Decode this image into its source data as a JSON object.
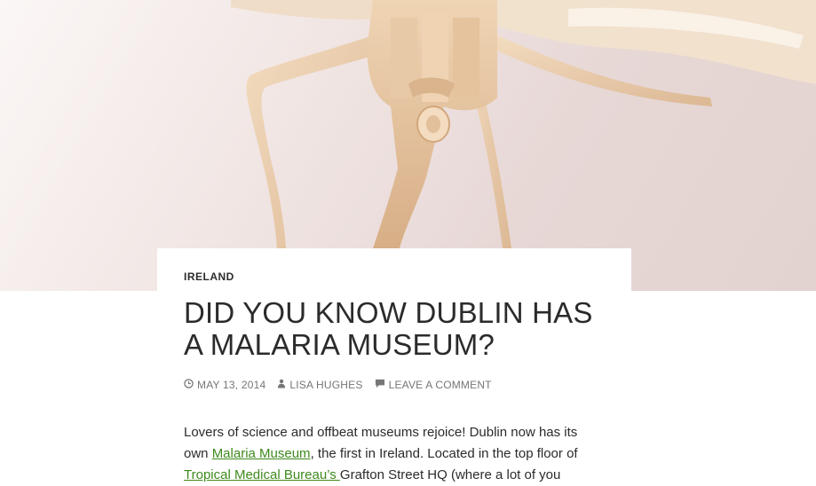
{
  "hero": {
    "image": "wooden-dragonfly-model-photo"
  },
  "post": {
    "category": "IRELAND",
    "title": "DID YOU KNOW DUBLIN HAS A MALARIA MUSEUM?",
    "meta": {
      "date": "MAY 13, 2014",
      "author": "LISA HUGHES",
      "comments": "LEAVE A COMMENT"
    },
    "body": {
      "p1_before": "Lovers of science and offbeat museums rejoice! Dublin now has its own ",
      "link1": "Malaria Museum",
      "p1_middle": ", the first in Ireland. Located in the top floor of ",
      "link2": "Tropical Medical Bureau’s ",
      "p1_after": "Grafton Street HQ (where a lot of you"
    }
  },
  "colors": {
    "link": "#3e8a1d",
    "text": "#2b2b2b",
    "meta": "#767676"
  },
  "icons": {
    "date": "clock-icon",
    "author": "user-icon",
    "comments": "comment-icon"
  }
}
